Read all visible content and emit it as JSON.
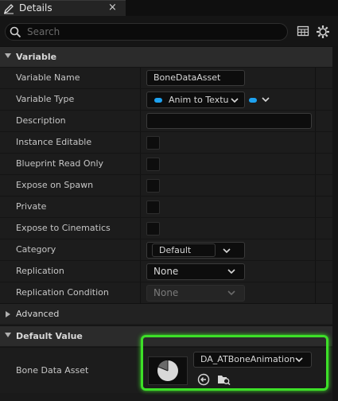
{
  "tab": {
    "title": "Details",
    "close": "×"
  },
  "search": {
    "placeholder": "Search"
  },
  "sections": {
    "variable": "Variable",
    "advanced": "Advanced",
    "default_value": "Default Value"
  },
  "rows": [
    {
      "label": "Variable Name",
      "value": "BoneDataAsset"
    },
    {
      "label": "Variable Type",
      "value": "Anim to Textu"
    },
    {
      "label": "Description",
      "value": ""
    },
    {
      "label": "Instance Editable",
      "checked": false
    },
    {
      "label": "Blueprint Read Only",
      "checked": false
    },
    {
      "label": "Expose on Spawn",
      "checked": false
    },
    {
      "label": "Private",
      "checked": false
    },
    {
      "label": "Expose to Cinematics",
      "checked": false
    },
    {
      "label": "Category",
      "value": "Default"
    },
    {
      "label": "Replication",
      "value": "None"
    },
    {
      "label": "Replication Condition",
      "value": "None"
    }
  ],
  "default_value": {
    "label": "Bone Data Asset",
    "asset": "DA_ATBoneAnimation"
  },
  "colors": {
    "accent_pin": "#1ea2f0",
    "highlight": "#3de028"
  },
  "icons": [
    "pencil-icon",
    "search-icon",
    "table-icon",
    "gear-icon",
    "chevron-down-icon",
    "pie-chart-icon",
    "use-selected-icon",
    "browse-icon"
  ]
}
